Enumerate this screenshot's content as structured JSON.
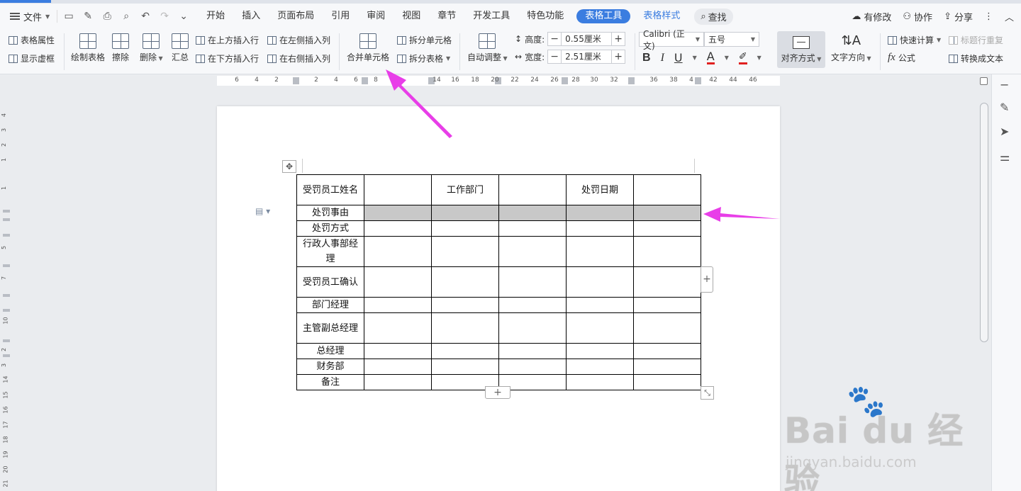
{
  "menubar": {
    "file_label": "文件",
    "tabs": [
      {
        "label": "开始"
      },
      {
        "label": "插入"
      },
      {
        "label": "页面布局"
      },
      {
        "label": "引用"
      },
      {
        "label": "审阅"
      },
      {
        "label": "视图"
      },
      {
        "label": "章节"
      },
      {
        "label": "开发工具"
      },
      {
        "label": "特色功能"
      },
      {
        "label": "表格工具"
      },
      {
        "label": "表格样式"
      }
    ],
    "search_label": "查找",
    "right": {
      "modified": "有修改",
      "collab": "协作",
      "share": "分享"
    }
  },
  "ribbon": {
    "table_props": "表格属性",
    "show_gridlines": "显示虚框",
    "draw_table": "绘制表格",
    "erase": "擦除",
    "delete": "删除",
    "summary": "汇总",
    "insert_above": "在上方插入行",
    "insert_below": "在下方插入行",
    "insert_left": "在左侧插入列",
    "insert_right": "在右侧插入列",
    "merge_cells": "合并单元格",
    "split_cells": "拆分单元格",
    "split_table": "拆分表格",
    "auto_adjust": "自动调整",
    "height_label": "高度:",
    "height_value": "0.55厘米",
    "width_label": "宽度:",
    "width_value": "2.51厘米",
    "font_name": "Calibri (正文)",
    "font_size": "五号",
    "align": "对齐方式",
    "text_direction": "文字方向",
    "quick_calc": "快速计算",
    "formula": "公式",
    "title_repeat": "标题行重复",
    "convert_text": "转换成文本",
    "bold": "B",
    "italic": "I",
    "underline": "U",
    "font_color": "A",
    "plus": "+",
    "minus": "−"
  },
  "ruler": {
    "numbers": [
      "6",
      "4",
      "2",
      "2",
      "4",
      "6",
      "8",
      "14",
      "16",
      "18",
      "20",
      "22",
      "24",
      "26",
      "28",
      "30",
      "32",
      "36",
      "38",
      "4",
      "42",
      "44",
      "46"
    ],
    "vnumbers": [
      "4",
      "3",
      "2",
      "1",
      "1",
      "5",
      "7",
      "10",
      "2",
      "3",
      "14",
      "15",
      "16",
      "17",
      "18",
      "19",
      "20",
      "21"
    ]
  },
  "table": {
    "rows": [
      [
        "受罚员工姓名",
        "",
        "工作部门",
        "",
        "处罚日期",
        ""
      ],
      [
        "处罚事由",
        "",
        "",
        "",
        "",
        ""
      ],
      [
        "处罚方式",
        "",
        "",
        "",
        "",
        ""
      ],
      [
        "行政人事部经理",
        "",
        "",
        "",
        "",
        ""
      ],
      [
        "受罚员工确认",
        "",
        "",
        "",
        "",
        ""
      ],
      [
        "部门经理",
        "",
        "",
        "",
        "",
        ""
      ],
      [
        "主管副总经理",
        "",
        "",
        "",
        "",
        ""
      ],
      [
        "总经理",
        "",
        "",
        "",
        "",
        ""
      ],
      [
        "财务部",
        "",
        "",
        "",
        "",
        ""
      ],
      [
        "备注",
        "",
        "",
        "",
        "",
        ""
      ]
    ]
  },
  "watermark": {
    "brand": "Bai du 经验",
    "url": "jingyan.baidu.com"
  },
  "colors": {
    "accent": "#3b7de0",
    "arrow": "#e83ee8",
    "selected_row": "#c8c8c8"
  }
}
